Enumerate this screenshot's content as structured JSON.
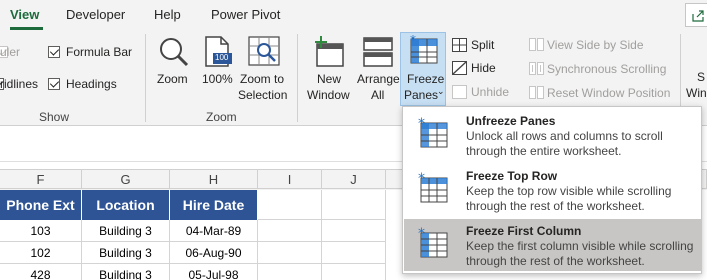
{
  "tabs": [
    {
      "label": "View",
      "active": true
    },
    {
      "label": "Developer"
    },
    {
      "label": "Help"
    },
    {
      "label": "Power Pivot"
    }
  ],
  "show_group": {
    "label": "Show",
    "ruler": "uler",
    "formula_bar": "Formula Bar",
    "gridlines": "ridlines",
    "headings": "Headings"
  },
  "zoom_group": {
    "label": "Zoom",
    "zoom": "Zoom",
    "zoom100": "100%",
    "zoom100_icon_text": "100",
    "zoom_sel_line1": "Zoom to",
    "zoom_sel_line2": "Selection"
  },
  "window_group": {
    "new_line1": "New",
    "new_line2": "Window",
    "arrange_line1": "Arrange",
    "arrange_line2": "All",
    "freeze_line1": "Freeze",
    "freeze_line2": "Panes",
    "split": "Split",
    "hide": "Hide",
    "unhide": "Unhide",
    "side_by_side": "View Side by Side",
    "sync_scroll": "Synchronous Scrolling",
    "reset_pos": "Reset Window Position",
    "switch_line1": "S",
    "switch_line2": "Win"
  },
  "freeze_menu": [
    {
      "title": "Unfreeze Panes",
      "underline_char": "n",
      "desc": "Unlock all rows and columns to scroll through the entire worksheet."
    },
    {
      "title": "Freeze Top Row",
      "underline_char": "R",
      "desc": "Keep the top row visible while scrolling through the rest of the worksheet."
    },
    {
      "title": "Freeze First Column",
      "underline_char": "C",
      "desc": "Keep the first column visible while scrolling through the rest of the worksheet.",
      "hover": true
    }
  ],
  "columns": [
    "F",
    "G",
    "H",
    "I",
    "J"
  ],
  "headers": [
    "Phone Ext",
    "Location",
    "Hire Date"
  ],
  "rows": [
    [
      "103",
      "Building 3",
      "04-Mar-89"
    ],
    [
      "102",
      "Building 3",
      "06-Aug-90"
    ],
    [
      "428",
      "Building 3",
      "05-Jul-98"
    ]
  ],
  "colors": {
    "accent": "#1d6b3c",
    "header_fill": "#2f5496",
    "freeze_active": "#c7dff2"
  }
}
